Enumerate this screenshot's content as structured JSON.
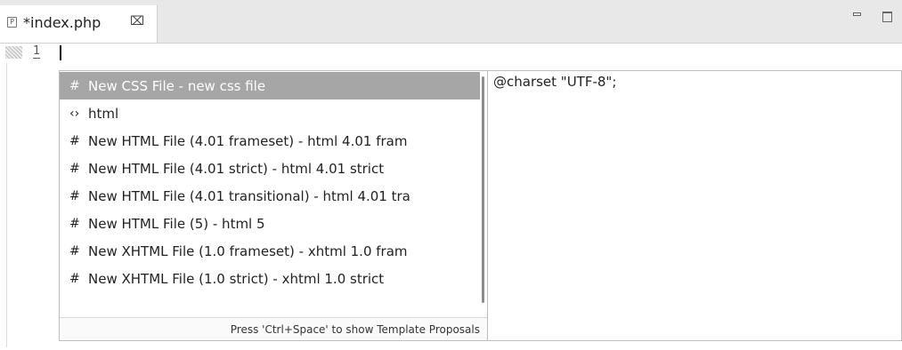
{
  "tab": {
    "icon": "P",
    "title": "*index.php",
    "close_icon": "⌧"
  },
  "editor": {
    "line_number": "1"
  },
  "completion": {
    "proposals": [
      {
        "icon": "#",
        "label": "New CSS File - new css file",
        "selected": true
      },
      {
        "icon": "‹›",
        "label": "html",
        "selected": false
      },
      {
        "icon": "#",
        "label": "New HTML File (4.01 frameset) - html 4.01 fram",
        "selected": false
      },
      {
        "icon": "#",
        "label": "New HTML File (4.01 strict) - html 4.01 strict",
        "selected": false
      },
      {
        "icon": "#",
        "label": "New HTML File (4.01 transitional) - html 4.01 tra",
        "selected": false
      },
      {
        "icon": "#",
        "label": "New HTML File (5) - html 5",
        "selected": false
      },
      {
        "icon": "#",
        "label": "New XHTML File (1.0 frameset) - xhtml 1.0 fram",
        "selected": false
      },
      {
        "icon": "#",
        "label": "New XHTML File (1.0 strict) - xhtml 1.0 strict",
        "selected": false
      }
    ],
    "footer": "Press 'Ctrl+Space' to show Template Proposals"
  },
  "preview": {
    "text": "@charset \"UTF-8\";"
  },
  "colors": {
    "selected_bg": "#a6a6a6",
    "tabbar_bg": "#e8e8e8"
  }
}
